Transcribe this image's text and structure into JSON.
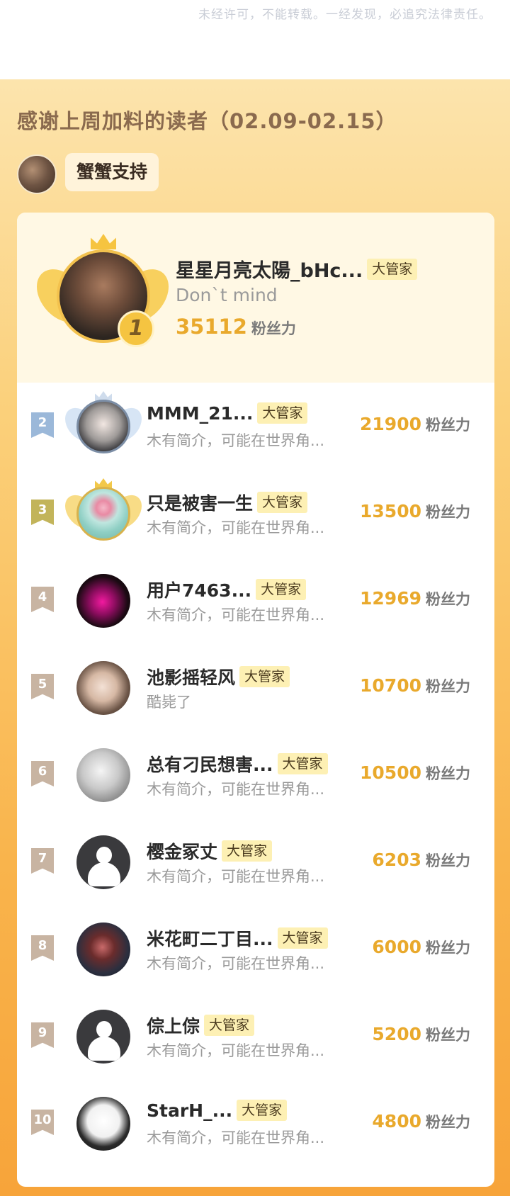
{
  "notice": "未经许可，不能转载。一经发现，必追究法律责任。",
  "panel": {
    "title": "感谢上周加料的读者（02.09-02.15）",
    "sponsor_label": "蟹蟹支持"
  },
  "top": {
    "rank": "1",
    "name": "星星月亮太陽_bHc...",
    "badge": "大管家",
    "desc": "Don`t mind",
    "score": "35112",
    "unit": "粉丝力"
  },
  "unit": "粉丝力",
  "badge": "大管家",
  "rows": [
    {
      "rank": "2",
      "name": "MMM_21...",
      "desc": "木有简介，可能在世界角...",
      "score": "21900",
      "ribbon": "#9bb8d9",
      "avatar": "girl",
      "frame": "silver"
    },
    {
      "rank": "3",
      "name": "只是被害一生",
      "desc": "木有简介，可能在世界角...",
      "score": "13500",
      "ribbon": "#c2b45a",
      "avatar": "lotus",
      "frame": "gold"
    },
    {
      "rank": "4",
      "name": "用户7463...",
      "desc": "木有简介，可能在世界角...",
      "score": "12969",
      "ribbon": "#c8b4a2",
      "avatar": "dark-pink",
      "frame": "none"
    },
    {
      "rank": "5",
      "name": "池影摇轻风",
      "desc": "酷毙了",
      "score": "10700",
      "ribbon": "#c8b4a2",
      "avatar": "boy",
      "frame": "none"
    },
    {
      "rank": "6",
      "name": "总有刁民想害...",
      "desc": "木有简介，可能在世界角...",
      "score": "10500",
      "ribbon": "#c8b4a2",
      "avatar": "sketch",
      "frame": "none"
    },
    {
      "rank": "7",
      "name": "樱金冢丈",
      "desc": "木有简介，可能在世界角...",
      "score": "6203",
      "ribbon": "#c8b4a2",
      "avatar": "default",
      "frame": "none"
    },
    {
      "rank": "8",
      "name": "米花町二丁目...",
      "desc": "木有简介，可能在世界角...",
      "score": "6000",
      "ribbon": "#c8b4a2",
      "avatar": "anime",
      "frame": "none"
    },
    {
      "rank": "9",
      "name": "倧上倧",
      "desc": "木有简介，可能在世界角...",
      "score": "5200",
      "ribbon": "#c8b4a2",
      "avatar": "default",
      "frame": "none"
    },
    {
      "rank": "10",
      "name": "StarH_...",
      "desc": "木有简介，可能在世界角...",
      "score": "4800",
      "ribbon": "#c8b4a2",
      "avatar": "glasses",
      "frame": "none"
    }
  ],
  "colors": {
    "score": "#e9a92c",
    "badge_bg": "#fdf0b4",
    "panel_top": "#fce4ad",
    "panel_bottom": "#f7a43a"
  }
}
